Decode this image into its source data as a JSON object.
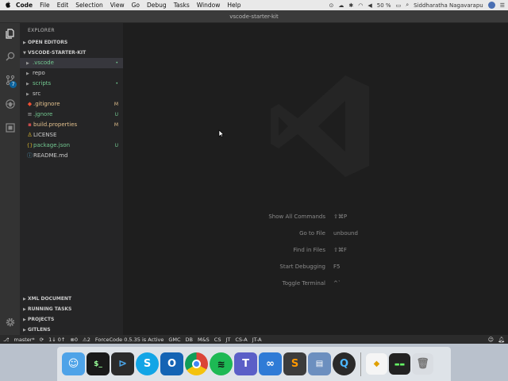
{
  "menubar": {
    "apple": "",
    "items": [
      "Code",
      "File",
      "Edit",
      "Selection",
      "View",
      "Go",
      "Debug",
      "Tasks",
      "Window",
      "Help"
    ],
    "battery": "50 %",
    "user": "Siddharatha Nagavarapu"
  },
  "window": {
    "title": "vscode-starter-kit"
  },
  "activity_bar": {
    "icons": [
      "files-icon",
      "search-icon",
      "source-control-icon",
      "debug-icon",
      "extensions-icon",
      "settings-gear-icon"
    ],
    "scm_badge": "7"
  },
  "sidebar": {
    "title": "EXPLORER",
    "open_editors": "OPEN EDITORS",
    "project": "VSCODE-STARTER-KIT",
    "tree": [
      {
        "name": ".vscode",
        "kind": "folder",
        "color": "green"
      },
      {
        "name": "repo",
        "kind": "folder",
        "color": "gray"
      },
      {
        "name": "scripts",
        "kind": "folder",
        "color": "green"
      },
      {
        "name": "src",
        "kind": "folder",
        "color": "gray"
      },
      {
        "name": ".gitignore",
        "kind": "file",
        "color": "orange",
        "status": "M"
      },
      {
        "name": ".jgnore",
        "kind": "file",
        "color": "green",
        "status": "U"
      },
      {
        "name": "build.properties",
        "kind": "file",
        "color": "orange",
        "status": "M"
      },
      {
        "name": "LICENSE",
        "kind": "file",
        "color": "gray"
      },
      {
        "name": "package.json",
        "kind": "file",
        "color": "green",
        "status": "U"
      },
      {
        "name": "README.md",
        "kind": "file",
        "color": "gray"
      }
    ],
    "bottom_sections": [
      "XML DOCUMENT",
      "RUNNING TASKS",
      "PROJECTS",
      "GITLENS"
    ]
  },
  "editor": {
    "hints": [
      {
        "label": "Show All Commands",
        "key": "⇧⌘P"
      },
      {
        "label": "Go to File",
        "key": "unbound"
      },
      {
        "label": "Find in Files",
        "key": "⇧⌘F"
      },
      {
        "label": "Start Debugging",
        "key": "F5"
      },
      {
        "label": "Toggle Terminal",
        "key": "^`"
      }
    ]
  },
  "statusbar": {
    "branch": "master*",
    "sync": "1↓ 0↑",
    "problems": "0",
    "warnings": "2",
    "items": [
      "ForceCode 0.5.35 is Active",
      "GMC",
      "DB",
      "M&S",
      "CS",
      "JT",
      "CS-A",
      "JT-A"
    ]
  },
  "dock": {
    "apps": [
      "finder-icon",
      "terminal-icon",
      "vscode-icon",
      "skype-icon",
      "outlook-icon",
      "chrome-icon",
      "spotify-icon",
      "teams-icon",
      "skype-business-icon",
      "sublime-icon",
      "preview-icon",
      "quicktime-icon"
    ],
    "right_apps": [
      "file-icon",
      "console-icon",
      "trash-icon"
    ]
  },
  "colors": {
    "accent": "#0e639c",
    "modified": "#e2c08d",
    "untracked": "#73c991",
    "sidebar": "#252526",
    "editor": "#1e1e1e"
  }
}
